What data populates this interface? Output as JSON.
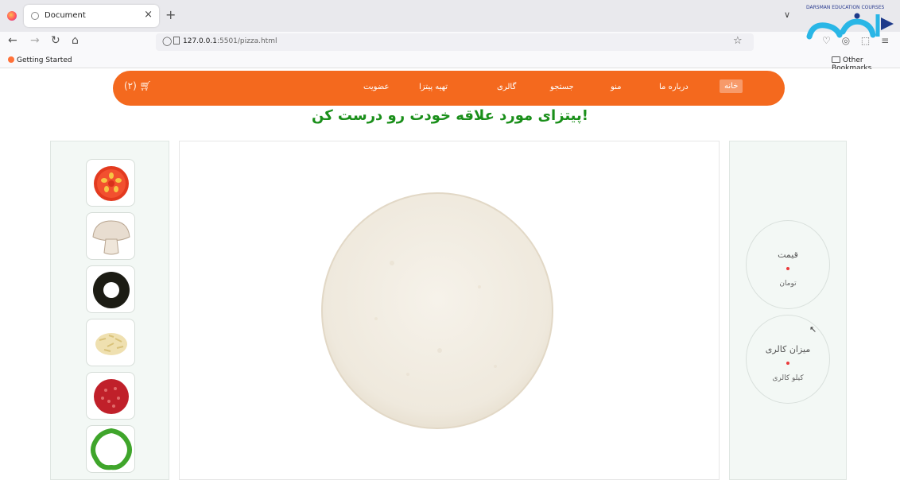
{
  "browser": {
    "tab_title": "Document",
    "tab_close": "×",
    "new_tab": "+",
    "tab_list": "∨",
    "url_host": "127.0.0.1",
    "url_rest": ":5501/pizza.html",
    "bookmark_start": "Getting Started",
    "bookmark_other": "Other Bookmarks"
  },
  "brand": {
    "text": "DARSMAN EDUCATION COURSES",
    "color": "#1e3a8a",
    "accent": "#29b6e6"
  },
  "site": {
    "accent": "#f4691e",
    "nav": {
      "home": "خانه",
      "about": "درباره ما",
      "menu": "منو",
      "search": "جستجو",
      "gallery": "گالری",
      "make_pizza": "تهیه پیتزا",
      "membership": "عضویت",
      "cart_count": "(۲)"
    },
    "heading": "پیتزای مورد علاقه خودت رو درست کن!",
    "ingredients": [
      "tomato",
      "mushroom",
      "olive",
      "cheese",
      "pepperoni",
      "green-pepper"
    ],
    "price": {
      "title": "قیمت",
      "unit": "تومان"
    },
    "calories": {
      "title": "میزان کالری",
      "unit": "کیلو کالری"
    }
  }
}
